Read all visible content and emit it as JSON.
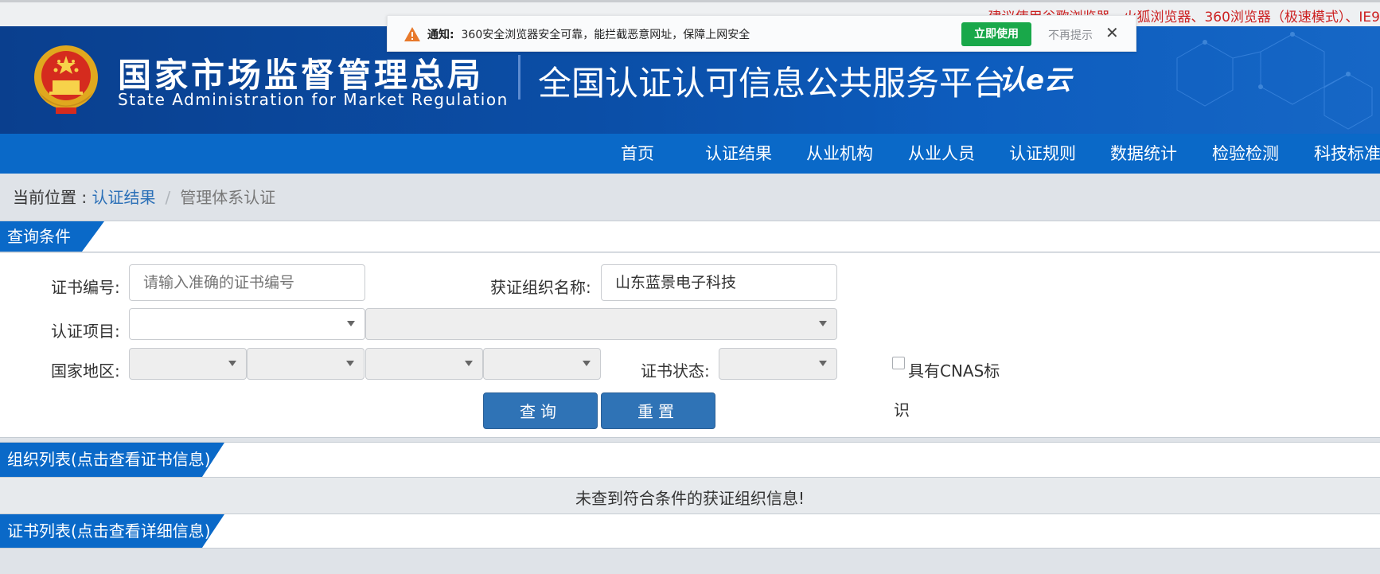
{
  "top_tip": "建议使用谷歌浏览器、火狐浏览器、360浏览器（极速模式）、IE9",
  "notice": {
    "label": "通知:",
    "text": "360安全浏览器安全可靠，能拦截恶意网址，保障上网安全",
    "use_button": "立即使用",
    "dismiss": "不再提示",
    "close": "✕"
  },
  "header": {
    "agency_cn": "国家市场监督管理总局",
    "agency_en": "State Administration  for  Market Regulation",
    "platform": "全国认证认可信息公共服务平台",
    "logo_text": "认e云"
  },
  "nav": [
    "首页",
    "认证结果",
    "从业机构",
    "从业人员",
    "认证规则",
    "数据统计",
    "检验检测",
    "科技标准"
  ],
  "breadcrumb": {
    "prefix": "当前位置 :",
    "link": "认证结果",
    "separator": "/",
    "current": "管理体系认证"
  },
  "sections": {
    "query": "查询条件",
    "org_list": "组织列表(点击查看证书信息)",
    "cert_list": "证书列表(点击查看详细信息)"
  },
  "form": {
    "cert_no_label": "证书编号:",
    "cert_no_placeholder": "请输入准确的证书编号",
    "org_name_label": "获证组织名称:",
    "org_name_value": "山东蓝景电子科技",
    "project_label": "认证项目:",
    "region_label": "国家地区:",
    "status_label": "证书状态:",
    "cnas_label_line1": "具有CNAS标",
    "cnas_label_line2": "识",
    "query_button": "查询",
    "reset_button": "重置"
  },
  "empty_message": "未查到符合条件的获证组织信息!",
  "colors": {
    "header_blue": "#0b4fa8",
    "nav_blue": "#0a69c8",
    "button_blue": "#2f73b6",
    "notice_green": "#19a84a",
    "tip_red": "#cc2222"
  }
}
